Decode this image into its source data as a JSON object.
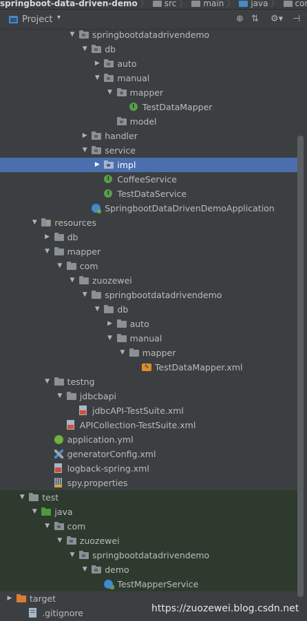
{
  "breadcrumbs": [
    "springboot-data-driven-demo",
    "src",
    "main",
    "java",
    "com"
  ],
  "toolbar": {
    "title": "Project",
    "dropdown_glyph": "▾",
    "buttons": [
      {
        "name": "locate-icon",
        "glyph": "⊕"
      },
      {
        "name": "collapse-all-icon",
        "glyph": "⇅"
      },
      {
        "name": "settings-icon",
        "glyph": "⚙▾"
      },
      {
        "name": "hide-icon",
        "glyph": "⊣"
      }
    ]
  },
  "tree": [
    {
      "label": "springbootdatadrivendemo",
      "level": 6,
      "arrow": "down",
      "icon": "package"
    },
    {
      "label": "db",
      "level": 7,
      "arrow": "down",
      "icon": "package"
    },
    {
      "label": "auto",
      "level": 8,
      "arrow": "right",
      "icon": "package"
    },
    {
      "label": "manual",
      "level": 8,
      "arrow": "down",
      "icon": "package"
    },
    {
      "label": "mapper",
      "level": 9,
      "arrow": "down",
      "icon": "package"
    },
    {
      "label": "TestDataMapper",
      "level": 10,
      "arrow": "",
      "icon": "interface"
    },
    {
      "label": "model",
      "level": 9,
      "arrow": "",
      "icon": "package"
    },
    {
      "label": "handler",
      "level": 7,
      "arrow": "right",
      "icon": "package"
    },
    {
      "label": "service",
      "level": 7,
      "arrow": "down",
      "icon": "package"
    },
    {
      "label": "impl",
      "level": 8,
      "arrow": "right",
      "icon": "package-selected",
      "selected": true
    },
    {
      "label": "CoffeeService",
      "level": 8,
      "arrow": "",
      "icon": "interface"
    },
    {
      "label": "TestDataService",
      "level": 8,
      "arrow": "",
      "icon": "interface"
    },
    {
      "label": "SpringbootDataDrivenDemoApplication",
      "level": 7,
      "arrow": "",
      "icon": "spring-app"
    },
    {
      "label": "resources",
      "level": 3,
      "arrow": "down",
      "icon": "resources"
    },
    {
      "label": "db",
      "level": 4,
      "arrow": "right",
      "icon": "folder"
    },
    {
      "label": "mapper",
      "level": 4,
      "arrow": "down",
      "icon": "folder"
    },
    {
      "label": "com",
      "level": 5,
      "arrow": "down",
      "icon": "folder"
    },
    {
      "label": "zuozewei",
      "level": 6,
      "arrow": "down",
      "icon": "folder"
    },
    {
      "label": "springbootdatadrivendemo",
      "level": 7,
      "arrow": "down",
      "icon": "folder"
    },
    {
      "label": "db",
      "level": 8,
      "arrow": "down",
      "icon": "folder"
    },
    {
      "label": "auto",
      "level": 9,
      "arrow": "right",
      "icon": "folder"
    },
    {
      "label": "manual",
      "level": 9,
      "arrow": "down",
      "icon": "folder"
    },
    {
      "label": "mapper",
      "level": 10,
      "arrow": "down",
      "icon": "folder"
    },
    {
      "label": "TestDataMapper.xml",
      "level": 11,
      "arrow": "",
      "icon": "mybatis-xml"
    },
    {
      "label": "testng",
      "level": 4,
      "arrow": "down",
      "icon": "folder"
    },
    {
      "label": "jdbcbapi",
      "level": 5,
      "arrow": "down",
      "icon": "folder"
    },
    {
      "label": "jdbcAPI-TestSuite.xml",
      "level": 6,
      "arrow": "",
      "icon": "testng-suite"
    },
    {
      "label": "APICollection-TestSuite.xml",
      "level": 5,
      "arrow": "",
      "icon": "testng-suite"
    },
    {
      "label": "application.yml",
      "level": 4,
      "arrow": "",
      "icon": "spring-yml"
    },
    {
      "label": "generatorConfig.xml",
      "level": 4,
      "arrow": "",
      "icon": "generator-config"
    },
    {
      "label": "logback-spring.xml",
      "level": 4,
      "arrow": "",
      "icon": "logback-xml"
    },
    {
      "label": "spy.properties",
      "level": 4,
      "arrow": "",
      "icon": "properties"
    },
    {
      "label": "test",
      "level": 2,
      "arrow": "down",
      "icon": "folder",
      "test": true
    },
    {
      "label": "java",
      "level": 3,
      "arrow": "down",
      "icon": "test-source",
      "test": true
    },
    {
      "label": "com",
      "level": 4,
      "arrow": "down",
      "icon": "package",
      "test": true
    },
    {
      "label": "zuozewei",
      "level": 5,
      "arrow": "down",
      "icon": "package",
      "test": true
    },
    {
      "label": "springbootdatadrivendemo",
      "level": 6,
      "arrow": "down",
      "icon": "package",
      "test": true
    },
    {
      "label": "demo",
      "level": 7,
      "arrow": "down",
      "icon": "package",
      "test": true
    },
    {
      "label": "TestMapperService",
      "level": 8,
      "arrow": "",
      "icon": "test-class",
      "test": true
    },
    {
      "label": "target",
      "level": 1,
      "arrow": "right",
      "icon": "excluded-folder"
    },
    {
      "label": ".gitignore",
      "level": 2,
      "arrow": "",
      "icon": "text-file"
    }
  ],
  "watermark": "https://zuozewei.blog.csdn.net",
  "colors": {
    "background": "#3c3f41",
    "selection": "#4b6eaf",
    "test_row": "#2f3a2f",
    "text": "#bbbbbb"
  }
}
